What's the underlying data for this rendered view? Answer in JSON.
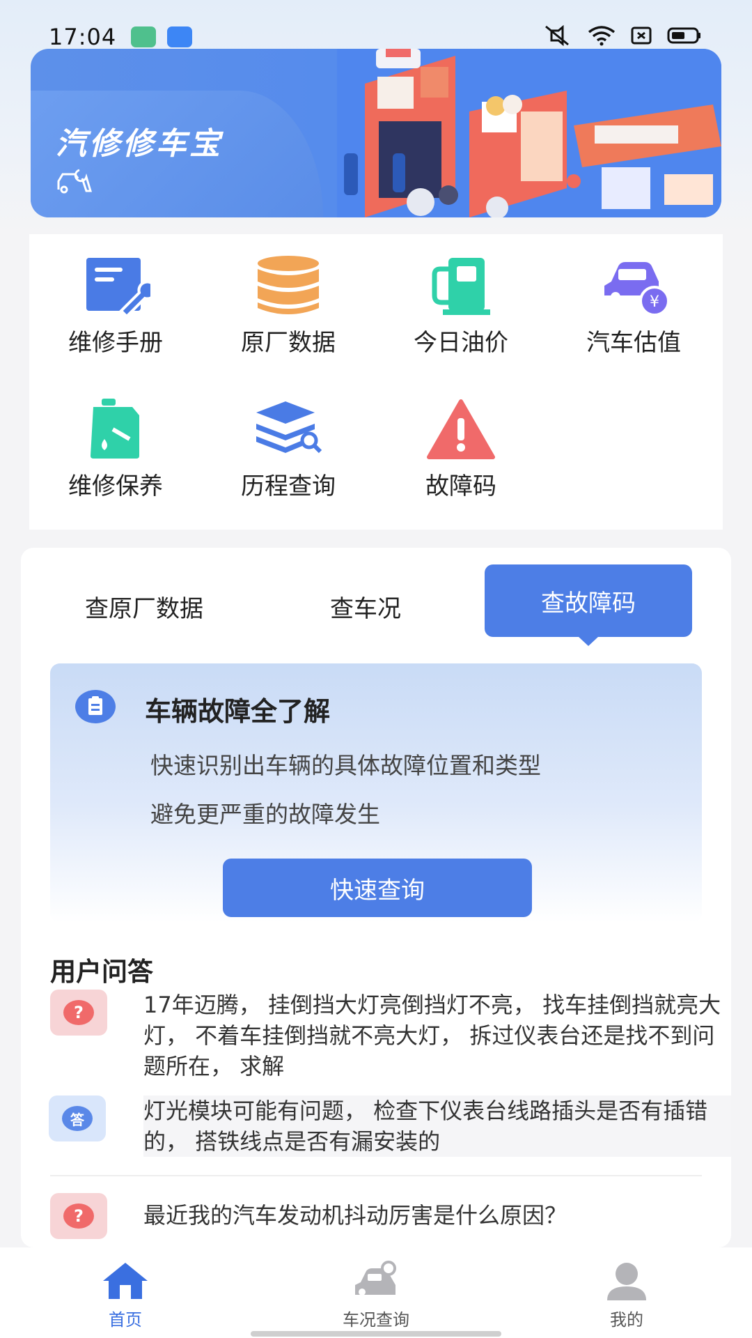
{
  "status_bar": {
    "time": "17:04"
  },
  "banner": {
    "title": "汽修修车宝"
  },
  "services": [
    {
      "label": "维修手册",
      "icon": "repair-manual-icon",
      "color": "#4a7be5"
    },
    {
      "label": "原厂数据",
      "icon": "database-icon",
      "color": "#f2a556"
    },
    {
      "label": "今日油价",
      "icon": "fuel-pump-icon",
      "color": "#2fd1a9"
    },
    {
      "label": "汽车估值",
      "icon": "car-valuation-icon",
      "color": "#7a6cf0"
    },
    {
      "label": "维修保养",
      "icon": "oil-can-icon",
      "color": "#2fd1a9"
    },
    {
      "label": "历程查询",
      "icon": "history-search-icon",
      "color": "#4a7be5"
    },
    {
      "label": "故障码",
      "icon": "warning-icon",
      "color": "#f06a6a"
    }
  ],
  "query_tabs": {
    "tab1": "查原厂数据",
    "tab2": "查车况",
    "tab3": "查故障码",
    "active": "查故障码"
  },
  "promo": {
    "title": "车辆故障全了解",
    "line1": "快速识别出车辆的具体故障位置和类型",
    "line2": "避免更严重的故障发生",
    "button": "快速查询"
  },
  "qa": {
    "heading": "用户问答",
    "items": [
      {
        "badge": "?",
        "text": "17年迈腾， 挂倒挡大灯亮倒挡灯不亮， 找车挂倒挡就亮大灯， 不着车挂倒挡就不亮大灯， 拆过仪表台还是找不到问题所在， 求解"
      },
      {
        "badge": "答",
        "text": "灯光模块可能有问题， 检查下仪表台线路插头是否有插错的， 搭铁线点是否有漏安装的"
      },
      {
        "badge": "?",
        "text": "最近我的汽车发动机抖动厉害是什么原因？"
      }
    ]
  },
  "bottom_nav": {
    "home": "首页",
    "car_status": "车况查询",
    "mine": "我的",
    "active": "首页"
  },
  "colors": {
    "accent": "#4d7ee6",
    "active_nav": "#3a6fe0"
  }
}
